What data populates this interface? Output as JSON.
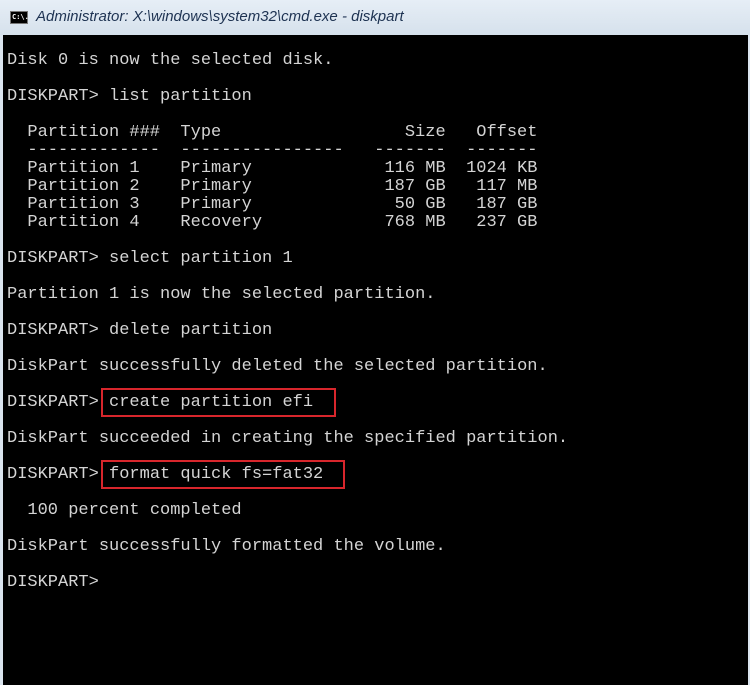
{
  "window": {
    "title": "Administrator: X:\\windows\\system32\\cmd.exe - diskpart",
    "icon": "cmd-icon",
    "icon_text": "C:\\."
  },
  "console": {
    "prompt": "DISKPART>",
    "lines": [
      "Disk 0 is now the selected disk.",
      "DISKPART> list partition",
      "DISKPART> select partition 1",
      "Partition 1 is now the selected partition.",
      "DISKPART> delete partition",
      "DiskPart successfully deleted the selected partition.",
      "DISKPART> create partition efi",
      "DiskPart succeeded in creating the specified partition.",
      "DISKPART> format quick fs=fat32",
      "  100 percent completed",
      "DiskPart successfully formatted the volume.",
      "DISKPART>"
    ],
    "highlighted_commands": [
      "create partition efi",
      "format quick fs=fat32"
    ],
    "highlight_color": "#d8262c"
  },
  "partition_table": {
    "headers": [
      "Partition ###",
      "Type",
      "Size",
      "Offset"
    ],
    "separators": [
      "-------------",
      "----------------",
      "-------",
      "-------"
    ],
    "rows": [
      [
        "Partition 1",
        "Primary",
        "116 MB",
        "1024 KB"
      ],
      [
        "Partition 2",
        "Primary",
        "187 GB",
        "117 MB"
      ],
      [
        "Partition 3",
        "Primary",
        "50 GB",
        "187 GB"
      ],
      [
        "Partition 4",
        "Recovery",
        "768 MB",
        "237 GB"
      ]
    ]
  }
}
